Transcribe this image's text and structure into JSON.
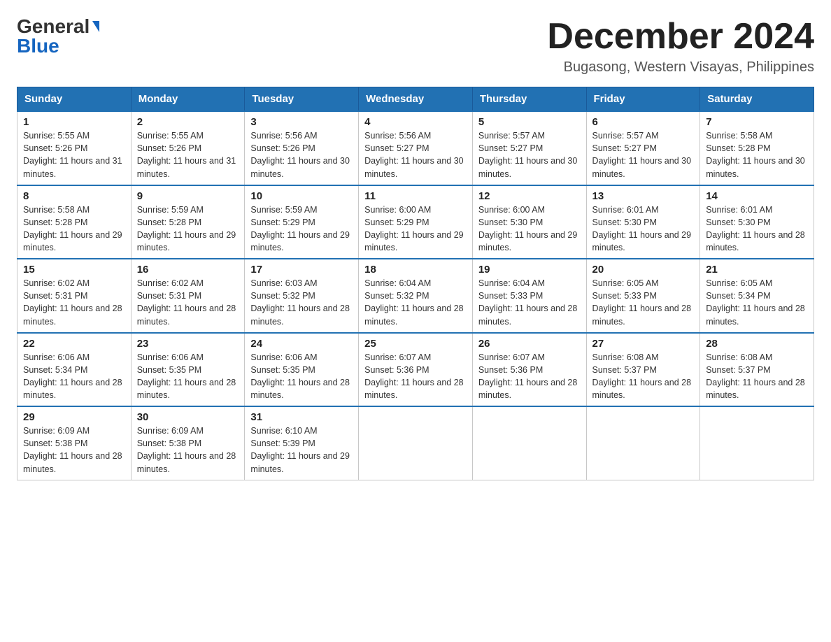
{
  "logo": {
    "general": "General",
    "blue": "Blue"
  },
  "title": {
    "month": "December 2024",
    "location": "Bugasong, Western Visayas, Philippines"
  },
  "headers": [
    "Sunday",
    "Monday",
    "Tuesday",
    "Wednesday",
    "Thursday",
    "Friday",
    "Saturday"
  ],
  "weeks": [
    [
      {
        "day": "1",
        "sunrise": "5:55 AM",
        "sunset": "5:26 PM",
        "daylight": "11 hours and 31 minutes."
      },
      {
        "day": "2",
        "sunrise": "5:55 AM",
        "sunset": "5:26 PM",
        "daylight": "11 hours and 31 minutes."
      },
      {
        "day": "3",
        "sunrise": "5:56 AM",
        "sunset": "5:26 PM",
        "daylight": "11 hours and 30 minutes."
      },
      {
        "day": "4",
        "sunrise": "5:56 AM",
        "sunset": "5:27 PM",
        "daylight": "11 hours and 30 minutes."
      },
      {
        "day": "5",
        "sunrise": "5:57 AM",
        "sunset": "5:27 PM",
        "daylight": "11 hours and 30 minutes."
      },
      {
        "day": "6",
        "sunrise": "5:57 AM",
        "sunset": "5:27 PM",
        "daylight": "11 hours and 30 minutes."
      },
      {
        "day": "7",
        "sunrise": "5:58 AM",
        "sunset": "5:28 PM",
        "daylight": "11 hours and 30 minutes."
      }
    ],
    [
      {
        "day": "8",
        "sunrise": "5:58 AM",
        "sunset": "5:28 PM",
        "daylight": "11 hours and 29 minutes."
      },
      {
        "day": "9",
        "sunrise": "5:59 AM",
        "sunset": "5:28 PM",
        "daylight": "11 hours and 29 minutes."
      },
      {
        "day": "10",
        "sunrise": "5:59 AM",
        "sunset": "5:29 PM",
        "daylight": "11 hours and 29 minutes."
      },
      {
        "day": "11",
        "sunrise": "6:00 AM",
        "sunset": "5:29 PM",
        "daylight": "11 hours and 29 minutes."
      },
      {
        "day": "12",
        "sunrise": "6:00 AM",
        "sunset": "5:30 PM",
        "daylight": "11 hours and 29 minutes."
      },
      {
        "day": "13",
        "sunrise": "6:01 AM",
        "sunset": "5:30 PM",
        "daylight": "11 hours and 29 minutes."
      },
      {
        "day": "14",
        "sunrise": "6:01 AM",
        "sunset": "5:30 PM",
        "daylight": "11 hours and 28 minutes."
      }
    ],
    [
      {
        "day": "15",
        "sunrise": "6:02 AM",
        "sunset": "5:31 PM",
        "daylight": "11 hours and 28 minutes."
      },
      {
        "day": "16",
        "sunrise": "6:02 AM",
        "sunset": "5:31 PM",
        "daylight": "11 hours and 28 minutes."
      },
      {
        "day": "17",
        "sunrise": "6:03 AM",
        "sunset": "5:32 PM",
        "daylight": "11 hours and 28 minutes."
      },
      {
        "day": "18",
        "sunrise": "6:04 AM",
        "sunset": "5:32 PM",
        "daylight": "11 hours and 28 minutes."
      },
      {
        "day": "19",
        "sunrise": "6:04 AM",
        "sunset": "5:33 PM",
        "daylight": "11 hours and 28 minutes."
      },
      {
        "day": "20",
        "sunrise": "6:05 AM",
        "sunset": "5:33 PM",
        "daylight": "11 hours and 28 minutes."
      },
      {
        "day": "21",
        "sunrise": "6:05 AM",
        "sunset": "5:34 PM",
        "daylight": "11 hours and 28 minutes."
      }
    ],
    [
      {
        "day": "22",
        "sunrise": "6:06 AM",
        "sunset": "5:34 PM",
        "daylight": "11 hours and 28 minutes."
      },
      {
        "day": "23",
        "sunrise": "6:06 AM",
        "sunset": "5:35 PM",
        "daylight": "11 hours and 28 minutes."
      },
      {
        "day": "24",
        "sunrise": "6:06 AM",
        "sunset": "5:35 PM",
        "daylight": "11 hours and 28 minutes."
      },
      {
        "day": "25",
        "sunrise": "6:07 AM",
        "sunset": "5:36 PM",
        "daylight": "11 hours and 28 minutes."
      },
      {
        "day": "26",
        "sunrise": "6:07 AM",
        "sunset": "5:36 PM",
        "daylight": "11 hours and 28 minutes."
      },
      {
        "day": "27",
        "sunrise": "6:08 AM",
        "sunset": "5:37 PM",
        "daylight": "11 hours and 28 minutes."
      },
      {
        "day": "28",
        "sunrise": "6:08 AM",
        "sunset": "5:37 PM",
        "daylight": "11 hours and 28 minutes."
      }
    ],
    [
      {
        "day": "29",
        "sunrise": "6:09 AM",
        "sunset": "5:38 PM",
        "daylight": "11 hours and 28 minutes."
      },
      {
        "day": "30",
        "sunrise": "6:09 AM",
        "sunset": "5:38 PM",
        "daylight": "11 hours and 28 minutes."
      },
      {
        "day": "31",
        "sunrise": "6:10 AM",
        "sunset": "5:39 PM",
        "daylight": "11 hours and 29 minutes."
      },
      null,
      null,
      null,
      null
    ]
  ]
}
